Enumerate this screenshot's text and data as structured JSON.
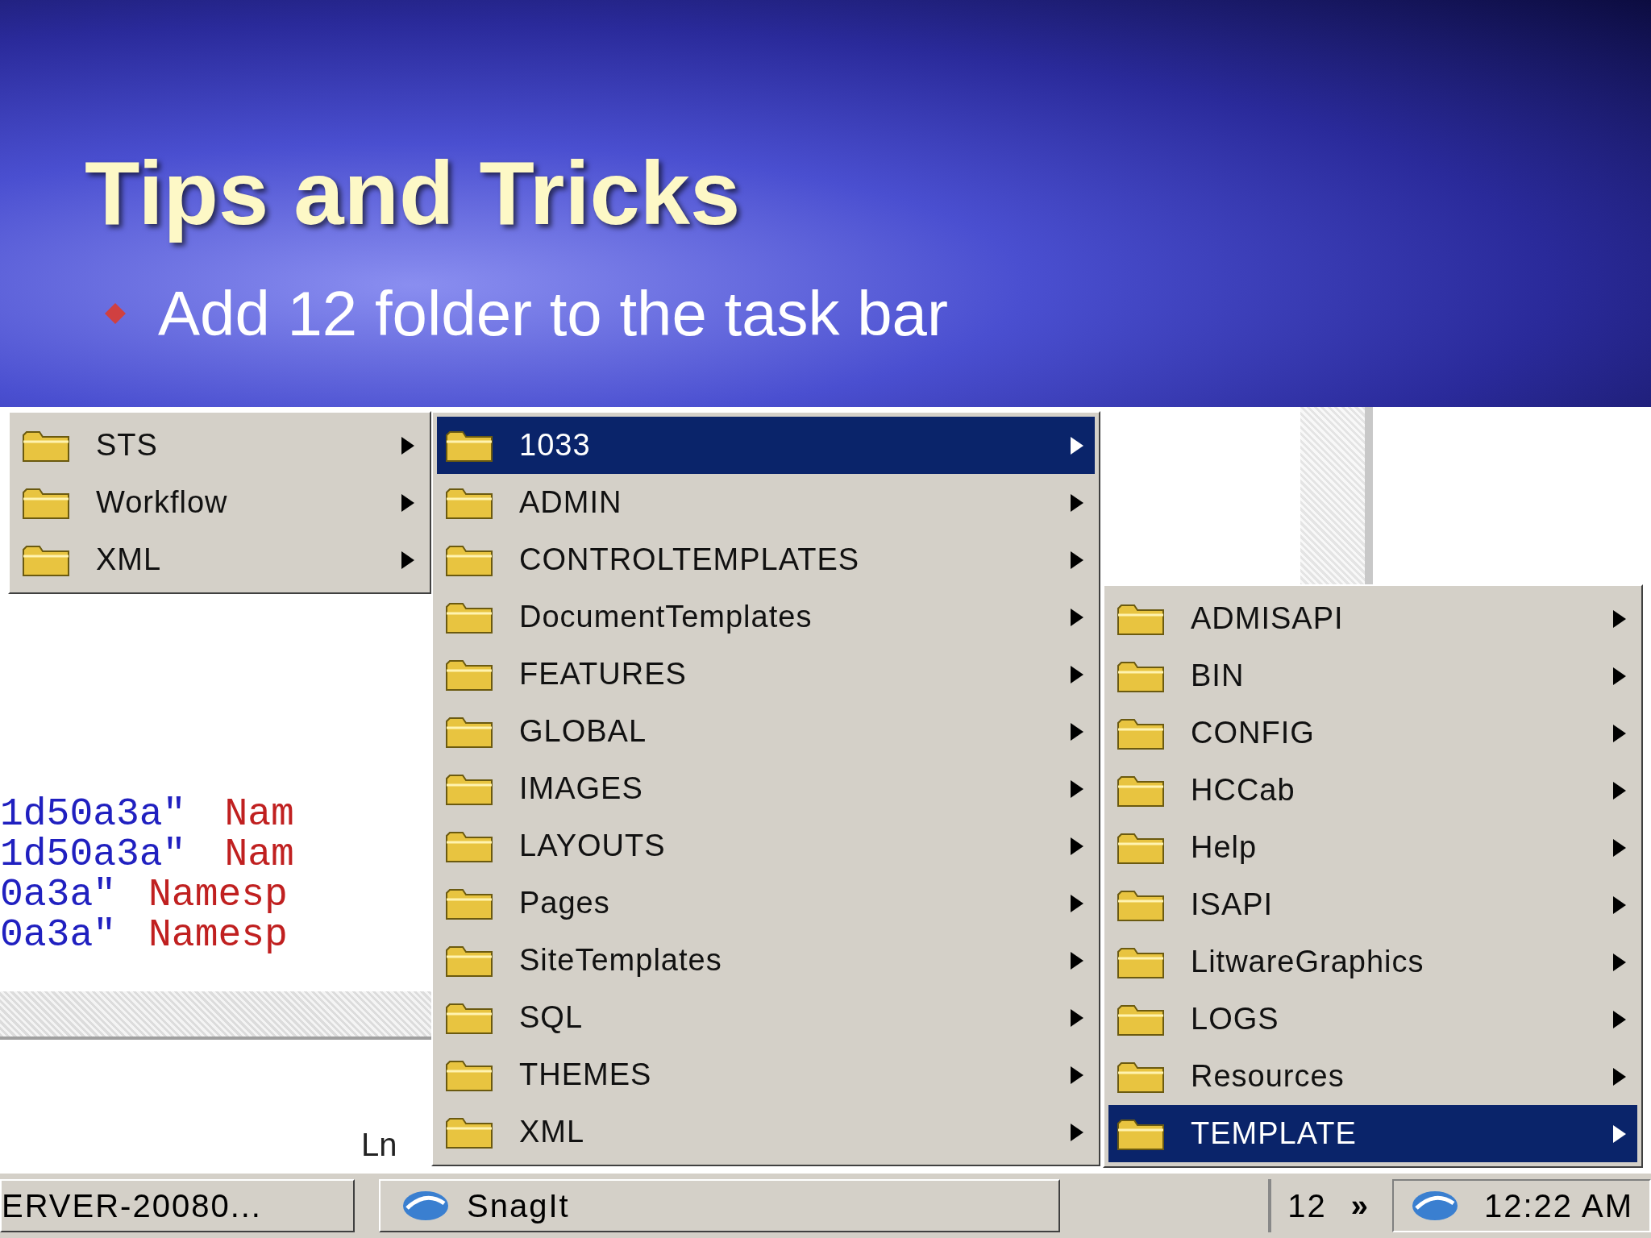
{
  "slide": {
    "title": "Tips and Tricks",
    "bullets": [
      "Add 12 folder to the task bar"
    ]
  },
  "screenshot": {
    "code_lines": [
      {
        "value": "1d50a3a\"",
        "attribute": "Nam"
      },
      {
        "value": "1d50a3a\"",
        "attribute": "Nam"
      },
      {
        "value": "0a3a\"",
        "attribute": "Namesp"
      },
      {
        "value": "0a3a\"",
        "attribute": "Namesp"
      }
    ],
    "status_text": "Ln",
    "menus": [
      {
        "items": [
          {
            "label": "STS",
            "selected": false
          },
          {
            "label": "Workflow",
            "selected": false
          },
          {
            "label": "XML",
            "selected": false
          }
        ]
      },
      {
        "items": [
          {
            "label": "1033",
            "selected": true
          },
          {
            "label": "ADMIN",
            "selected": false
          },
          {
            "label": "CONTROLTEMPLATES",
            "selected": false
          },
          {
            "label": "DocumentTemplates",
            "selected": false
          },
          {
            "label": "FEATURES",
            "selected": false
          },
          {
            "label": "GLOBAL",
            "selected": false
          },
          {
            "label": "IMAGES",
            "selected": false
          },
          {
            "label": "LAYOUTS",
            "selected": false
          },
          {
            "label": "Pages",
            "selected": false
          },
          {
            "label": "SiteTemplates",
            "selected": false
          },
          {
            "label": "SQL",
            "selected": false
          },
          {
            "label": "THEMES",
            "selected": false
          },
          {
            "label": "XML",
            "selected": false
          }
        ]
      },
      {
        "items": [
          {
            "label": "ADMISAPI",
            "selected": false
          },
          {
            "label": "BIN",
            "selected": false
          },
          {
            "label": "CONFIG",
            "selected": false
          },
          {
            "label": "HCCab",
            "selected": false
          },
          {
            "label": "Help",
            "selected": false
          },
          {
            "label": "ISAPI",
            "selected": false
          },
          {
            "label": "LitwareGraphics",
            "selected": false
          },
          {
            "label": "LOGS",
            "selected": false
          },
          {
            "label": "Resources",
            "selected": false
          },
          {
            "label": "TEMPLATE",
            "selected": true
          }
        ]
      }
    ],
    "taskbar": {
      "buttons": [
        {
          "label": "ERVER-20080...",
          "kind": "plain"
        },
        {
          "label": "SnagIt",
          "kind": "app"
        }
      ],
      "toolbar_label": "12",
      "chevron": "»",
      "clock": "12:22 AM"
    }
  }
}
